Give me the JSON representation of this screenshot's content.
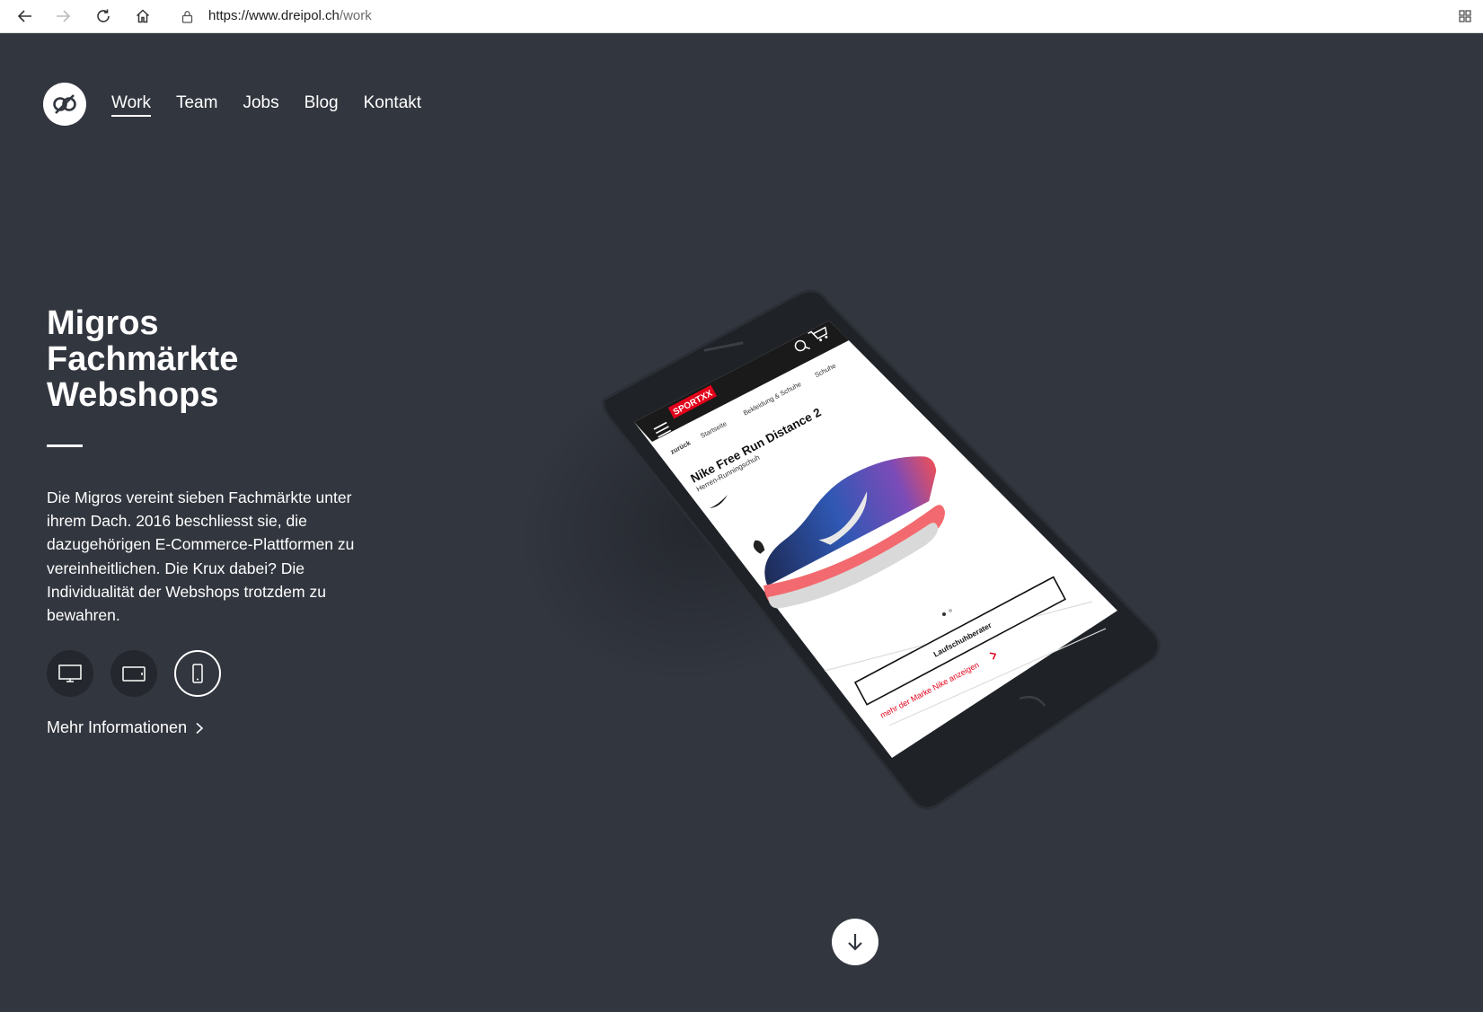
{
  "browser": {
    "url_domain": "https://www.dreipol.ch",
    "url_path": "/work"
  },
  "nav": {
    "items": [
      {
        "label": "Work",
        "active": true
      },
      {
        "label": "Team",
        "active": false
      },
      {
        "label": "Jobs",
        "active": false
      },
      {
        "label": "Blog",
        "active": false
      },
      {
        "label": "Kontakt",
        "active": false
      }
    ]
  },
  "project": {
    "title_line1": "Migros",
    "title_line2": "Fachmärkte",
    "title_line3": "Webshops",
    "description": "Die Migros vereint sieben Fachmärkte unter ihrem Dach. 2016 beschliesst sie, die dazugehörigen E-Commerce-Plattformen zu vereinheitlichen. Die Krux dabei? Die Individualität der Webshops trotzdem zu bewahren.",
    "devices": [
      {
        "icon": "desktop-icon",
        "active": false
      },
      {
        "icon": "tablet-icon",
        "active": false
      },
      {
        "icon": "mobile-icon",
        "active": true
      }
    ],
    "more_label": "Mehr Informationen"
  },
  "phone_screen": {
    "brand": "SPORTXX",
    "breadcrumb_back": "zurück",
    "breadcrumb_1": "Startseite",
    "breadcrumb_2": "Bekleidung & Schuhe",
    "breadcrumb_3": "Schuhe",
    "product_title": "Nike Free Run Distance 2",
    "product_subtitle": "Herren-Runningschuh",
    "button_label": "Laufschuhberater",
    "brand_link": "mehr der Marke Nike anzeigen"
  },
  "colors": {
    "page_bg": "#32363f",
    "button_dark": "#24272d",
    "brand_red": "#e2001a"
  }
}
